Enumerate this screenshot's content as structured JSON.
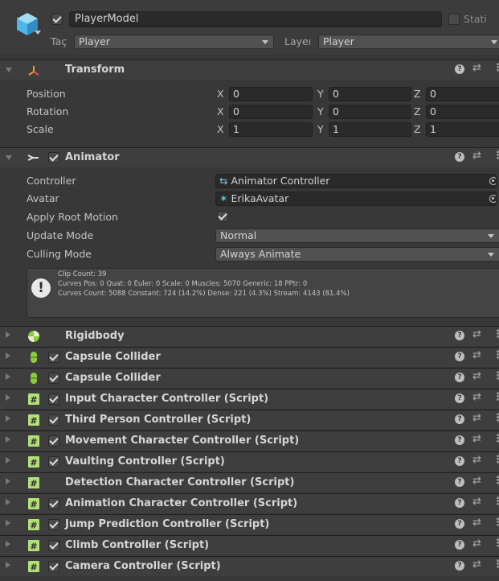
{
  "header": {
    "enabled": true,
    "name": "PlayerModel",
    "static_label": "Stati",
    "tag_label": "Taç",
    "tag_value": "Player",
    "layer_label": "Layeı",
    "layer_value": "Player"
  },
  "transform": {
    "title": "Transform",
    "rows": [
      {
        "label": "Position",
        "x": "0",
        "y": "0",
        "z": "0"
      },
      {
        "label": "Rotation",
        "x": "0",
        "y": "0",
        "z": "0"
      },
      {
        "label": "Scale",
        "x": "1",
        "y": "1",
        "z": "1"
      }
    ],
    "axes": [
      "X",
      "Y",
      "Z"
    ]
  },
  "animator": {
    "title": "Animator",
    "enabled": true,
    "controller_label": "Controller",
    "controller_value": "Animator Controller",
    "avatar_label": "Avatar",
    "avatar_value": "ErikaAvatar",
    "root_motion_label": "Apply Root Motion",
    "root_motion_value": true,
    "update_mode_label": "Update Mode",
    "update_mode_value": "Normal",
    "culling_mode_label": "Culling Mode",
    "culling_mode_value": "Always Animate",
    "info_lines": [
      "Clip Count: 39",
      "Curves Pos: 0 Quat: 0 Euler: 0 Scale: 0 Muscles: 5070 Generic: 18 PPtr: 0",
      "Curves Count: 5088 Constant: 724 (14.2%) Dense: 221 (4.3%) Stream: 4143 (81.4%)"
    ]
  },
  "components": [
    {
      "title": "Rigidbody",
      "icon": "rigidbody-icon",
      "checkbox": false
    },
    {
      "title": "Capsule Collider",
      "icon": "capsule-collider-icon",
      "checkbox": true
    },
    {
      "title": "Capsule Collider",
      "icon": "capsule-collider-icon",
      "checkbox": true
    },
    {
      "title": "Input Character Controller (Script)",
      "icon": "script-icon",
      "checkbox": true
    },
    {
      "title": "Third Person Controller (Script)",
      "icon": "script-icon",
      "checkbox": true
    },
    {
      "title": "Movement Character Controller (Script)",
      "icon": "script-icon",
      "checkbox": true
    },
    {
      "title": "Vaulting Controller (Script)",
      "icon": "script-icon",
      "checkbox": true
    },
    {
      "title": "Detection Character Controller (Script)",
      "icon": "script-icon",
      "checkbox": false
    },
    {
      "title": "Animation Character Controller (Script)",
      "icon": "script-icon",
      "checkbox": true
    },
    {
      "title": "Jump Prediction Controller (Script)",
      "icon": "script-icon",
      "checkbox": true
    },
    {
      "title": "Climb Controller (Script)",
      "icon": "script-icon",
      "checkbox": true
    },
    {
      "title": "Camera Controller (Script)",
      "icon": "script-icon",
      "checkbox": true
    }
  ],
  "colors": {
    "background": "#383838",
    "header_bg": "#3e3e3e",
    "field_bg": "#2a2a2a",
    "accent_blue": "#4fb8e8",
    "transform_orange": "#f0a020",
    "collider_green": "#8ccb3c",
    "script_green": "#8ccb3c"
  }
}
